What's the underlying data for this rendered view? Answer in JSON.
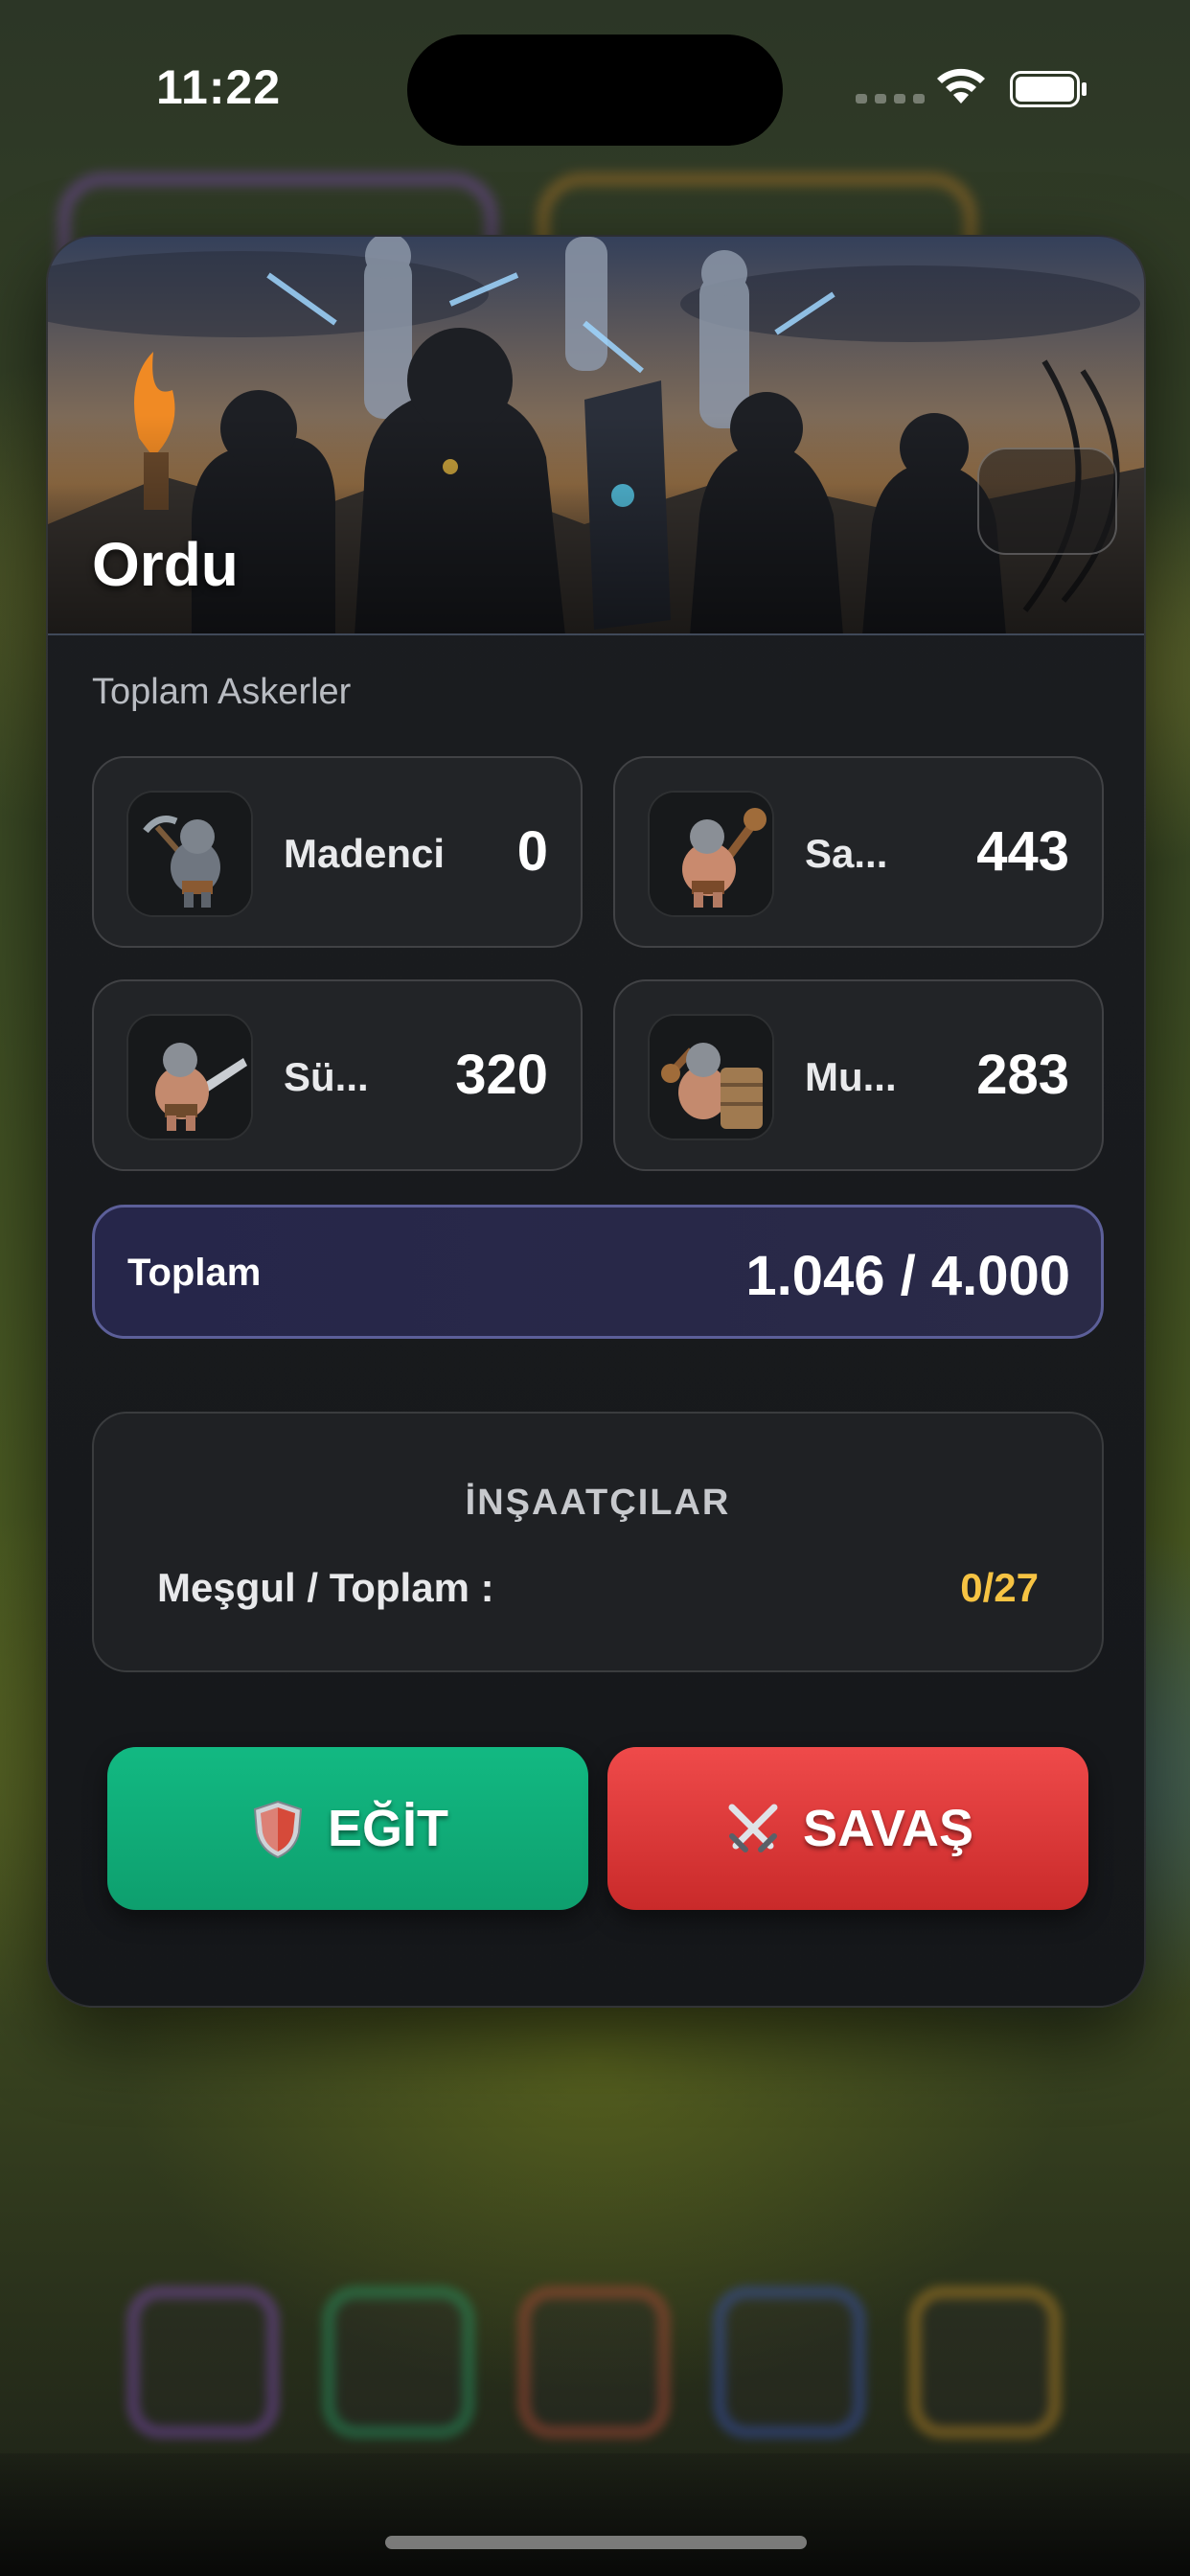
{
  "status_bar": {
    "time": "11:22"
  },
  "modal": {
    "title": "Ordu",
    "section_label": "Toplam Askerler",
    "units": [
      {
        "name": "Madenci",
        "count": "0",
        "icon": "miner-icon"
      },
      {
        "name": "Sa...",
        "count": "443",
        "icon": "club-warrior-icon"
      },
      {
        "name": "Sü...",
        "count": "320",
        "icon": "swordsman-icon"
      },
      {
        "name": "Mu...",
        "count": "283",
        "icon": "shield-warrior-icon"
      }
    ],
    "total": {
      "label": "Toplam",
      "value": "1.046 / 4.000"
    },
    "builders": {
      "title": "İNŞAATÇILAR",
      "label": "Meşgul / Toplam :",
      "value": "0/27"
    },
    "buttons": {
      "train": {
        "label": "EĞİT",
        "icon": "shield-icon"
      },
      "war": {
        "label": "SAVAŞ",
        "icon": "crossed-swords-icon"
      }
    }
  },
  "colors": {
    "train_button": "#10b07b",
    "war_button": "#e03c3c",
    "builders_value": "#f6c343",
    "total_border": "#5c5f99"
  }
}
